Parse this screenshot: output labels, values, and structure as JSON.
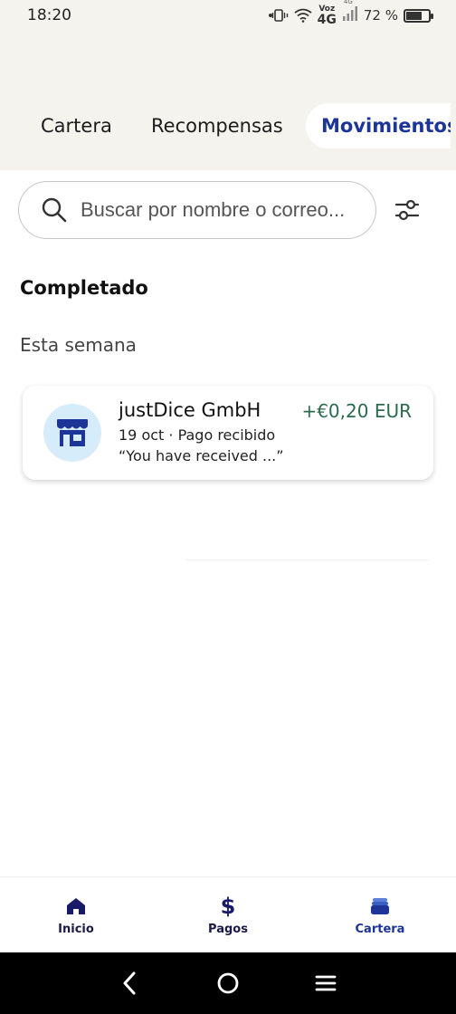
{
  "status_bar": {
    "time": "18:20",
    "network_top": "Voz",
    "network_type": "4G",
    "signal_label": "4G",
    "battery_percent": "72 %",
    "battery_level": 0.72
  },
  "tabs": [
    {
      "label": "Cartera",
      "active": false
    },
    {
      "label": "Recompensas",
      "active": false
    },
    {
      "label": "Movimientos",
      "active": true
    }
  ],
  "search": {
    "placeholder": "Buscar por nombre o correo..."
  },
  "activity": {
    "section_title": "Completado",
    "group_label": "Esta semana",
    "transactions": [
      {
        "name": "justDice GmbH",
        "amount": "+€0,20 EUR",
        "meta": "19 oct · Pago recibido",
        "note": "“You have received ...”",
        "icon": "store-icon"
      }
    ]
  },
  "bottom_nav": [
    {
      "label": "Inicio",
      "icon": "home-icon"
    },
    {
      "label": "Pagos",
      "icon": "dollar-icon"
    },
    {
      "label": "Cartera",
      "icon": "wallet-icon",
      "active": true
    }
  ],
  "colors": {
    "header_bg": "#f4f3ee",
    "brand_blue": "#1d3598",
    "amount_green": "#2b6a4c",
    "avatar_bg": "#d6ecfa"
  }
}
